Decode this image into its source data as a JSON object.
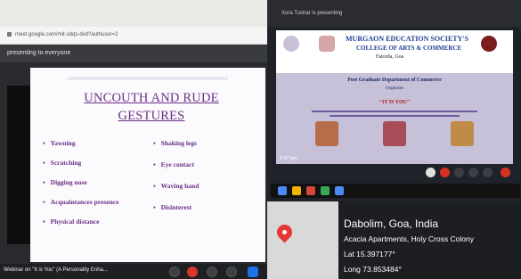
{
  "left_photo": {
    "url": "meet.google.com/mit-sdqs-dvd?authuser=2",
    "banner": "presenting to everyone",
    "slide": {
      "title_line1": "UNCOUTH AND RUDE",
      "title_line2": "GESTURES",
      "left_items": [
        "Yawning",
        "Scratching",
        "Digging nose",
        "Acquaintances presence",
        "Physical distance"
      ],
      "right_items": [
        "Shaking legs",
        "Eye contact",
        "Waving hand",
        "Disinterest"
      ],
      "accent_color": "#6b2e86"
    },
    "bottom_bar": {
      "meeting_title": "Webinar on \"It is You\" (A Personality Enha..."
    },
    "controls": [
      "mic-icon",
      "camera-icon",
      "captions-icon",
      "hand-icon",
      "present-icon"
    ]
  },
  "right_photo": {
    "top_bar": "Xora Tushar is presenting",
    "webinar_slide": {
      "society": "MURGAON EDUCATION SOCIETY'S",
      "college": "COLLEGE OF ARTS & COMMERCE",
      "place": "Fatorda, Goa",
      "department": "Post Graduate Department of Commerce",
      "organises": "Organises",
      "theme": "\"IT IS YOU\""
    },
    "status_time": "5:47 pm",
    "location": {
      "city": "Dabolim, Goa, India",
      "address": "Acacia Apartments, Holy Cross Colony",
      "lat": "Lat 15.397177°",
      "long": "Long 73.853484°"
    }
  }
}
